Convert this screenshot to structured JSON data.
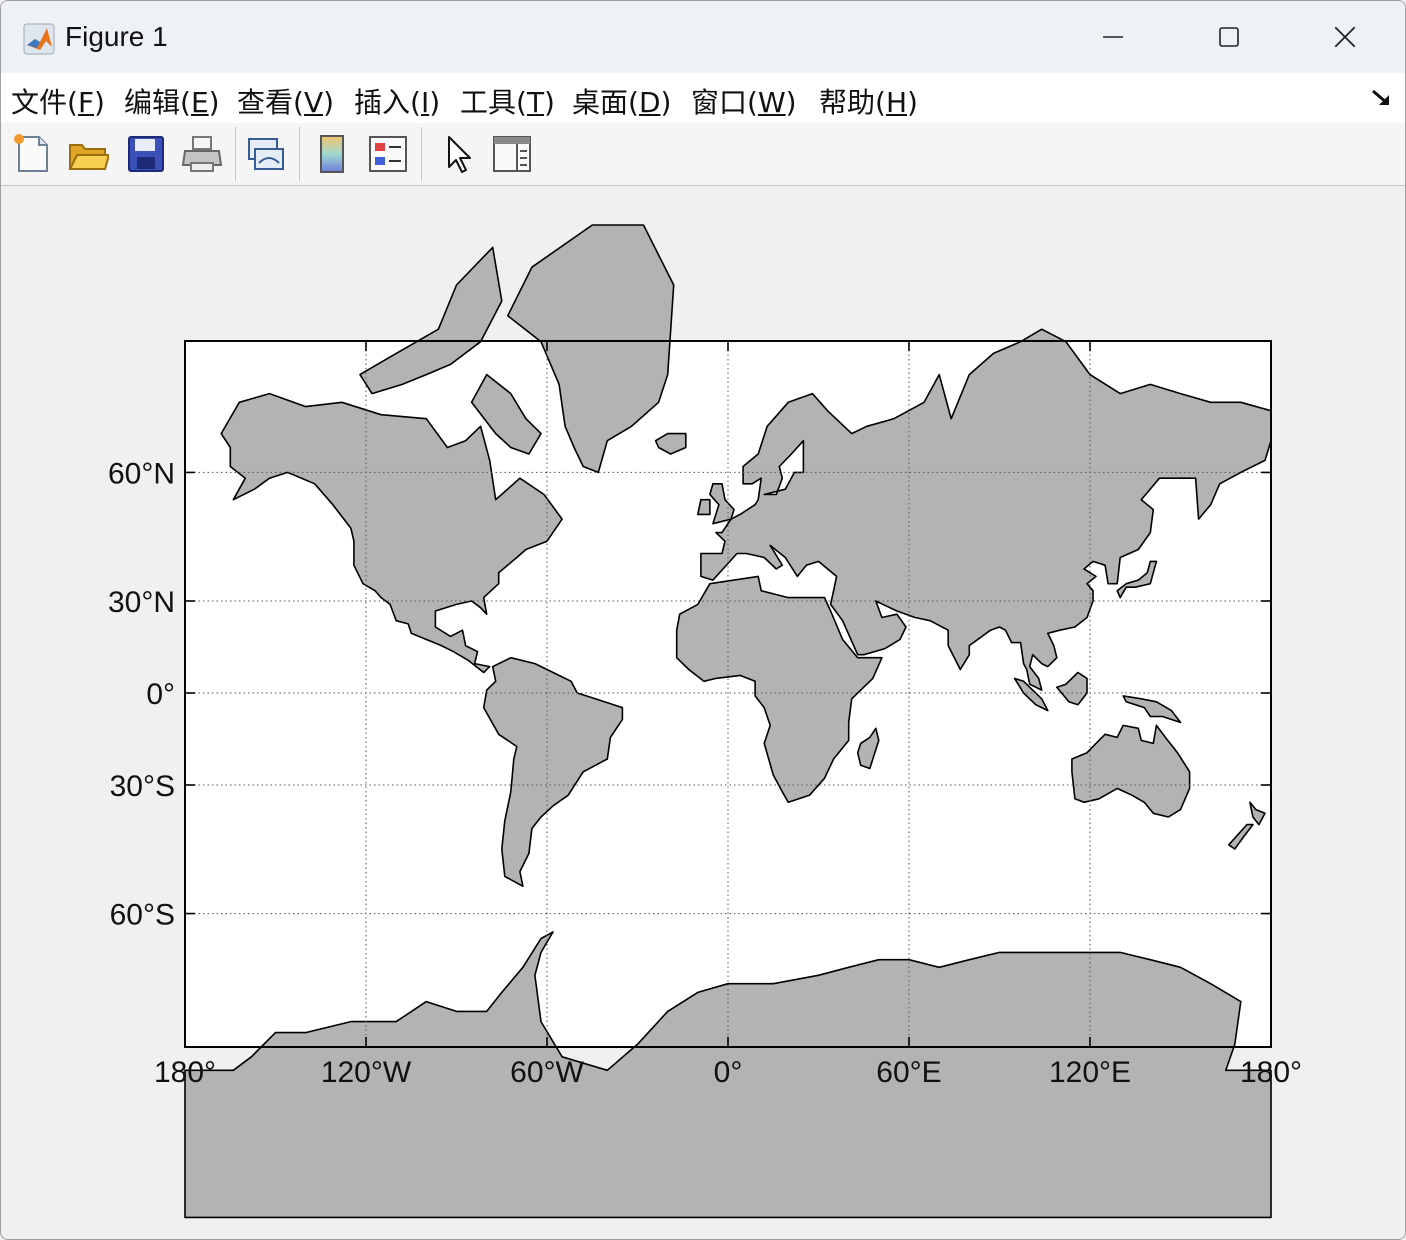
{
  "window": {
    "title": "Figure 1"
  },
  "menubar": {
    "items": [
      {
        "label": "文件(",
        "mnemonic": "F",
        "close": ")"
      },
      {
        "label": "编辑(",
        "mnemonic": "E",
        "close": ")"
      },
      {
        "label": "查看(",
        "mnemonic": "V",
        "close": ")"
      },
      {
        "label": "插入(",
        "mnemonic": "I",
        "close": ")"
      },
      {
        "label": "工具(",
        "mnemonic": "T",
        "close": ")"
      },
      {
        "label": "桌面(",
        "mnemonic": "D",
        "close": ")"
      },
      {
        "label": "窗口(",
        "mnemonic": "W",
        "close": ")"
      },
      {
        "label": "帮助(",
        "mnemonic": "H",
        "close": ")"
      }
    ]
  },
  "toolbar": {
    "icons": [
      "new-figure-icon",
      "open-file-icon",
      "save-icon",
      "print-icon",
      "link-plot-icon",
      "colorbar-icon",
      "legend-icon",
      "edit-plot-arrow-icon",
      "property-inspector-icon"
    ]
  },
  "colors": {
    "land": "#b3b3b3",
    "coast": "#000000",
    "ocean": "#ffffff",
    "grid": "#555555"
  },
  "map": {
    "projection": "Mercator",
    "lon_ticks": [
      -180,
      -120,
      -60,
      0,
      60,
      120,
      180
    ],
    "lon_labels": [
      "180°",
      "120°W",
      "60°W",
      "0°",
      "60°E",
      "120°E",
      "180°"
    ],
    "lat_ticks": [
      60,
      30,
      0,
      -30,
      -60
    ],
    "lat_labels": [
      "60°N",
      "30°N",
      "0°",
      "30°S",
      "60°S"
    ],
    "grid": "dotted"
  }
}
